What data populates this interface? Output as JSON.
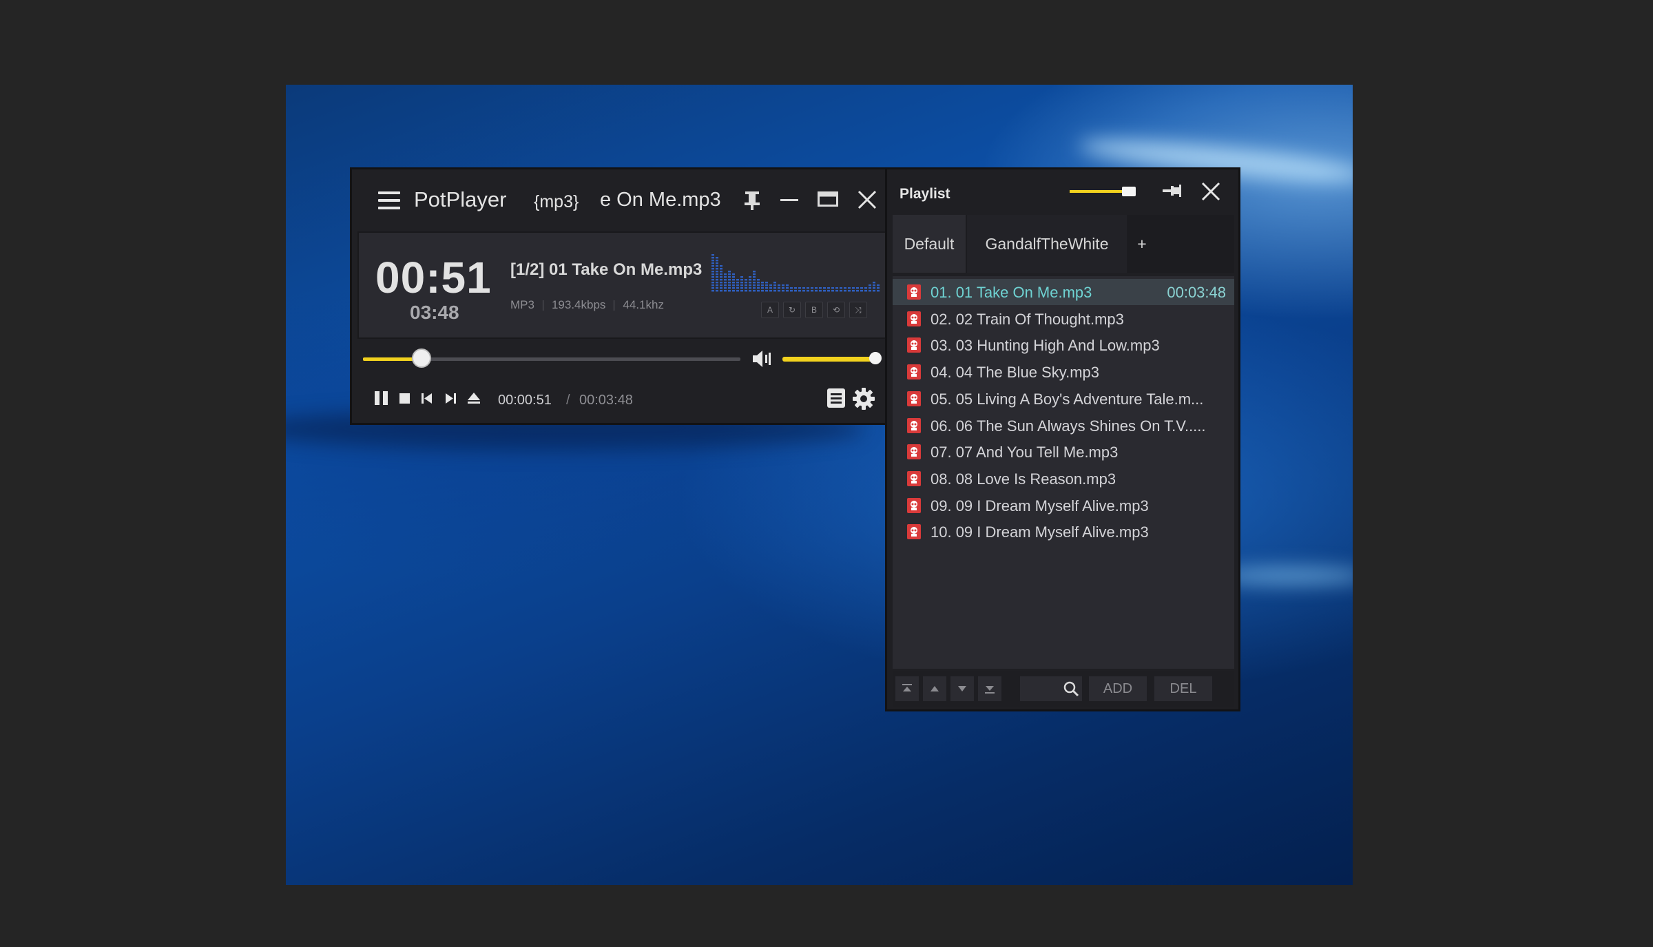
{
  "player": {
    "app_title": "PotPlayer",
    "title_ext": "{mp3}",
    "title_file": "e On Me.mp3",
    "elapsed_big": "00:51",
    "duration_small": "03:48",
    "track_title": "[1/2] 01 Take On Me.mp3",
    "format": "MP3",
    "bitrate": "193.4kbps",
    "samplerate": "44.1khz",
    "ab_buttons": [
      "A",
      "↻",
      "B",
      "⟲",
      "⤨"
    ],
    "seek_progress": 0.155,
    "volume_level": 0.95,
    "current_time": "00:00:51",
    "separator": "/",
    "total_time": "00:03:48",
    "accent_color": "#f2d21e"
  },
  "playlist": {
    "title": "Playlist",
    "tabs": [
      "Default",
      "GandalfTheWhite",
      "+"
    ],
    "active_tab": "Default",
    "items": [
      {
        "name": "01. 01 Take On Me.mp3",
        "duration": "00:03:48",
        "current": true
      },
      {
        "name": "02. 02 Train Of Thought.mp3"
      },
      {
        "name": "03. 03 Hunting High And Low.mp3"
      },
      {
        "name": "04. 04 The Blue Sky.mp3"
      },
      {
        "name": "05. 05 Living A Boy's Adventure Tale.m..."
      },
      {
        "name": "06. 06 The Sun Always Shines On T.V....."
      },
      {
        "name": "07. 07 And You Tell Me.mp3"
      },
      {
        "name": "08. 08 Love Is Reason.mp3"
      },
      {
        "name": "09. 09 I Dream Myself Alive.mp3"
      },
      {
        "name": "10. 09 I Dream Myself Alive.mp3"
      }
    ],
    "add_label": "ADD",
    "del_label": "DEL",
    "icons": [
      "move-top-icon",
      "move-up-icon",
      "move-down-icon",
      "move-bottom-icon",
      "search-icon"
    ]
  }
}
